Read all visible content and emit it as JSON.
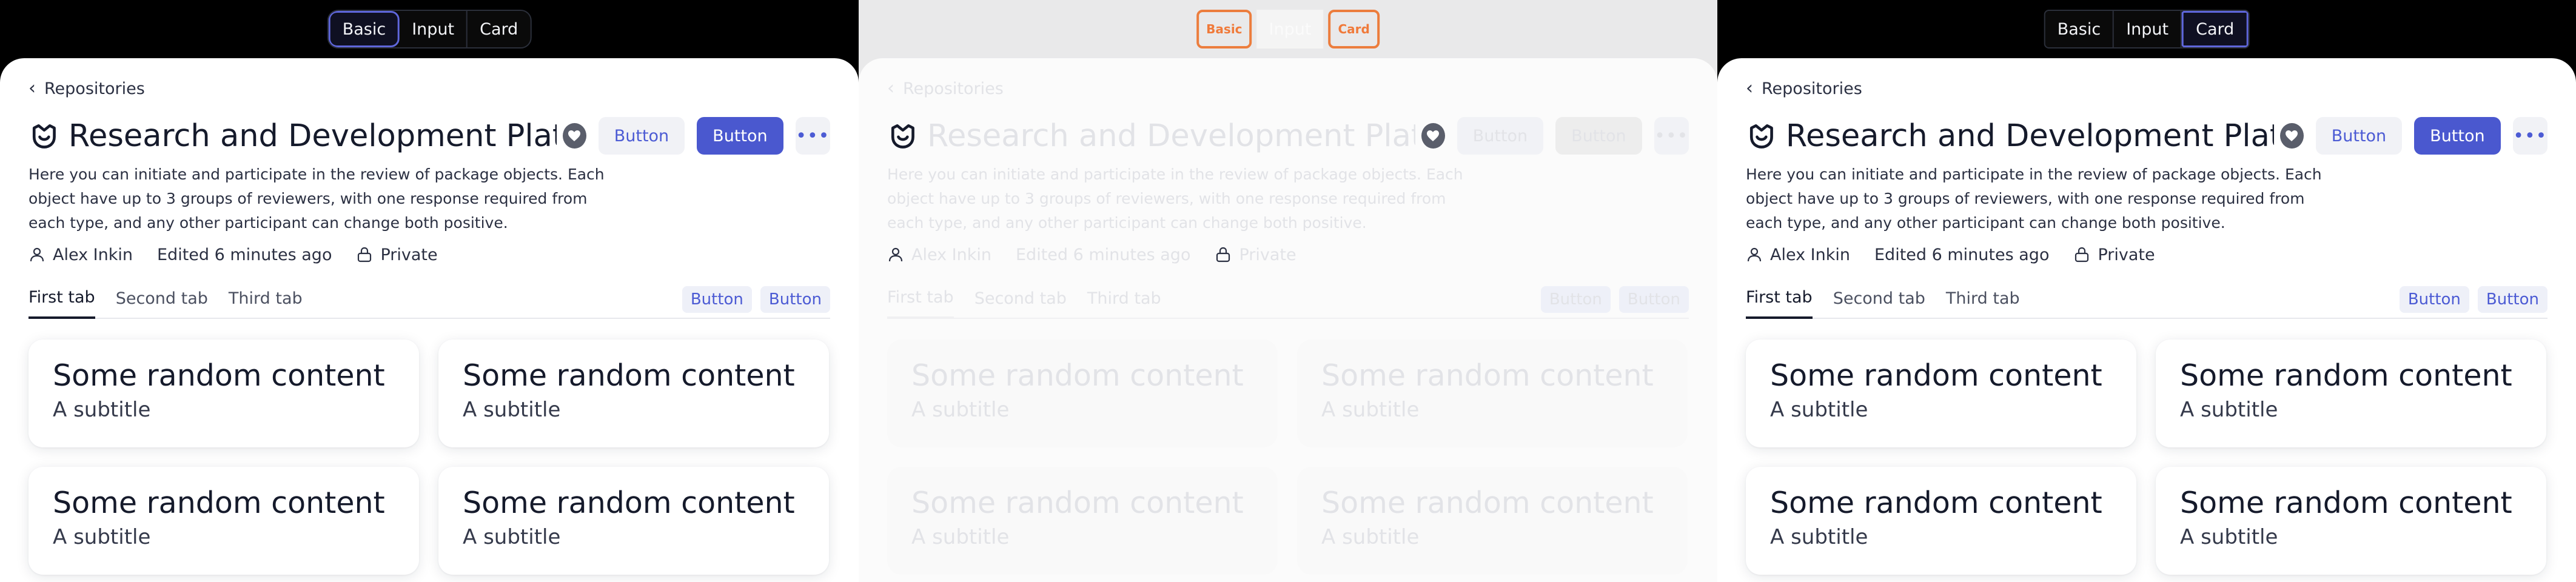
{
  "panels": [
    {
      "variant": "Basic",
      "switcher": [
        "Basic",
        "Input",
        "Card"
      ],
      "breadcrumb": "Repositories",
      "title": "Research and Development Platform",
      "buttons": {
        "secondary": "Button",
        "primary": "Button",
        "more": "•••"
      },
      "description": "Here you can initiate and participate in the review of package objects. Each object have up to 3 groups of reviewers, with one response required from each type, and any other participant can change both positive.",
      "meta": {
        "author": "Alex Inkin",
        "edited": "Edited 6 minutes ago",
        "visibility": "Private"
      },
      "tabs": [
        "First tab",
        "Second tab",
        "Third tab"
      ],
      "tab_buttons": [
        "Button",
        "Button"
      ],
      "cards": [
        {
          "title": "Some random content",
          "subtitle": "A subtitle"
        },
        {
          "title": "Some random content",
          "subtitle": "A subtitle"
        },
        {
          "title": "Some random content",
          "subtitle": "A subtitle"
        },
        {
          "title": "Some random content",
          "subtitle": "A subtitle"
        }
      ]
    },
    {
      "variant": "Input",
      "switcher": [
        "Basic",
        "Input",
        "Card"
      ],
      "breadcrumb": "Repositories",
      "title": "Research and Development Platform",
      "buttons": {
        "secondary": "Button",
        "primary": "Button",
        "more": "•••"
      },
      "description": "Here you can initiate and participate in the review of package objects. Each object have up to 3 groups of reviewers, with one response required from each type, and any other participant can change both positive.",
      "meta": {
        "author": "Alex Inkin",
        "edited": "Edited 6 minutes ago",
        "visibility": "Private"
      },
      "tabs": [
        "First tab",
        "Second tab",
        "Third tab"
      ],
      "tab_buttons": [
        "Button",
        "Button"
      ],
      "cards": [
        {
          "title": "Some random content",
          "subtitle": "A subtitle"
        },
        {
          "title": "Some random content",
          "subtitle": "A subtitle"
        },
        {
          "title": "Some random content",
          "subtitle": "A subtitle"
        },
        {
          "title": "Some random content",
          "subtitle": "A subtitle"
        }
      ]
    },
    {
      "variant": "Card",
      "switcher": [
        "Basic",
        "Input",
        "Card"
      ],
      "breadcrumb": "Repositories",
      "title": "Research and Development Platform",
      "buttons": {
        "secondary": "Button",
        "primary": "Button",
        "more": "•••"
      },
      "description": "Here you can initiate and participate in the review of package objects. Each object have up to 3 groups of reviewers, with one response required from each type, and any other participant can change both positive.",
      "meta": {
        "author": "Alex Inkin",
        "edited": "Edited 6 minutes ago",
        "visibility": "Private"
      },
      "tabs": [
        "First tab",
        "Second tab",
        "Third tab"
      ],
      "tab_buttons": [
        "Button",
        "Button"
      ],
      "cards": [
        {
          "title": "Some random content",
          "subtitle": "A subtitle"
        },
        {
          "title": "Some random content",
          "subtitle": "A subtitle"
        },
        {
          "title": "Some random content",
          "subtitle": "A subtitle"
        },
        {
          "title": "Some random content",
          "subtitle": "A subtitle"
        }
      ]
    }
  ],
  "colors": {
    "accent": "#4a58cf",
    "switcher_active_border": "#5f67dc",
    "glitch_orange": "#ec7d3d"
  },
  "icons": [
    "chevron-left-icon",
    "brand-logo-icon",
    "heart-icon",
    "user-icon",
    "lock-icon",
    "more-icon"
  ]
}
